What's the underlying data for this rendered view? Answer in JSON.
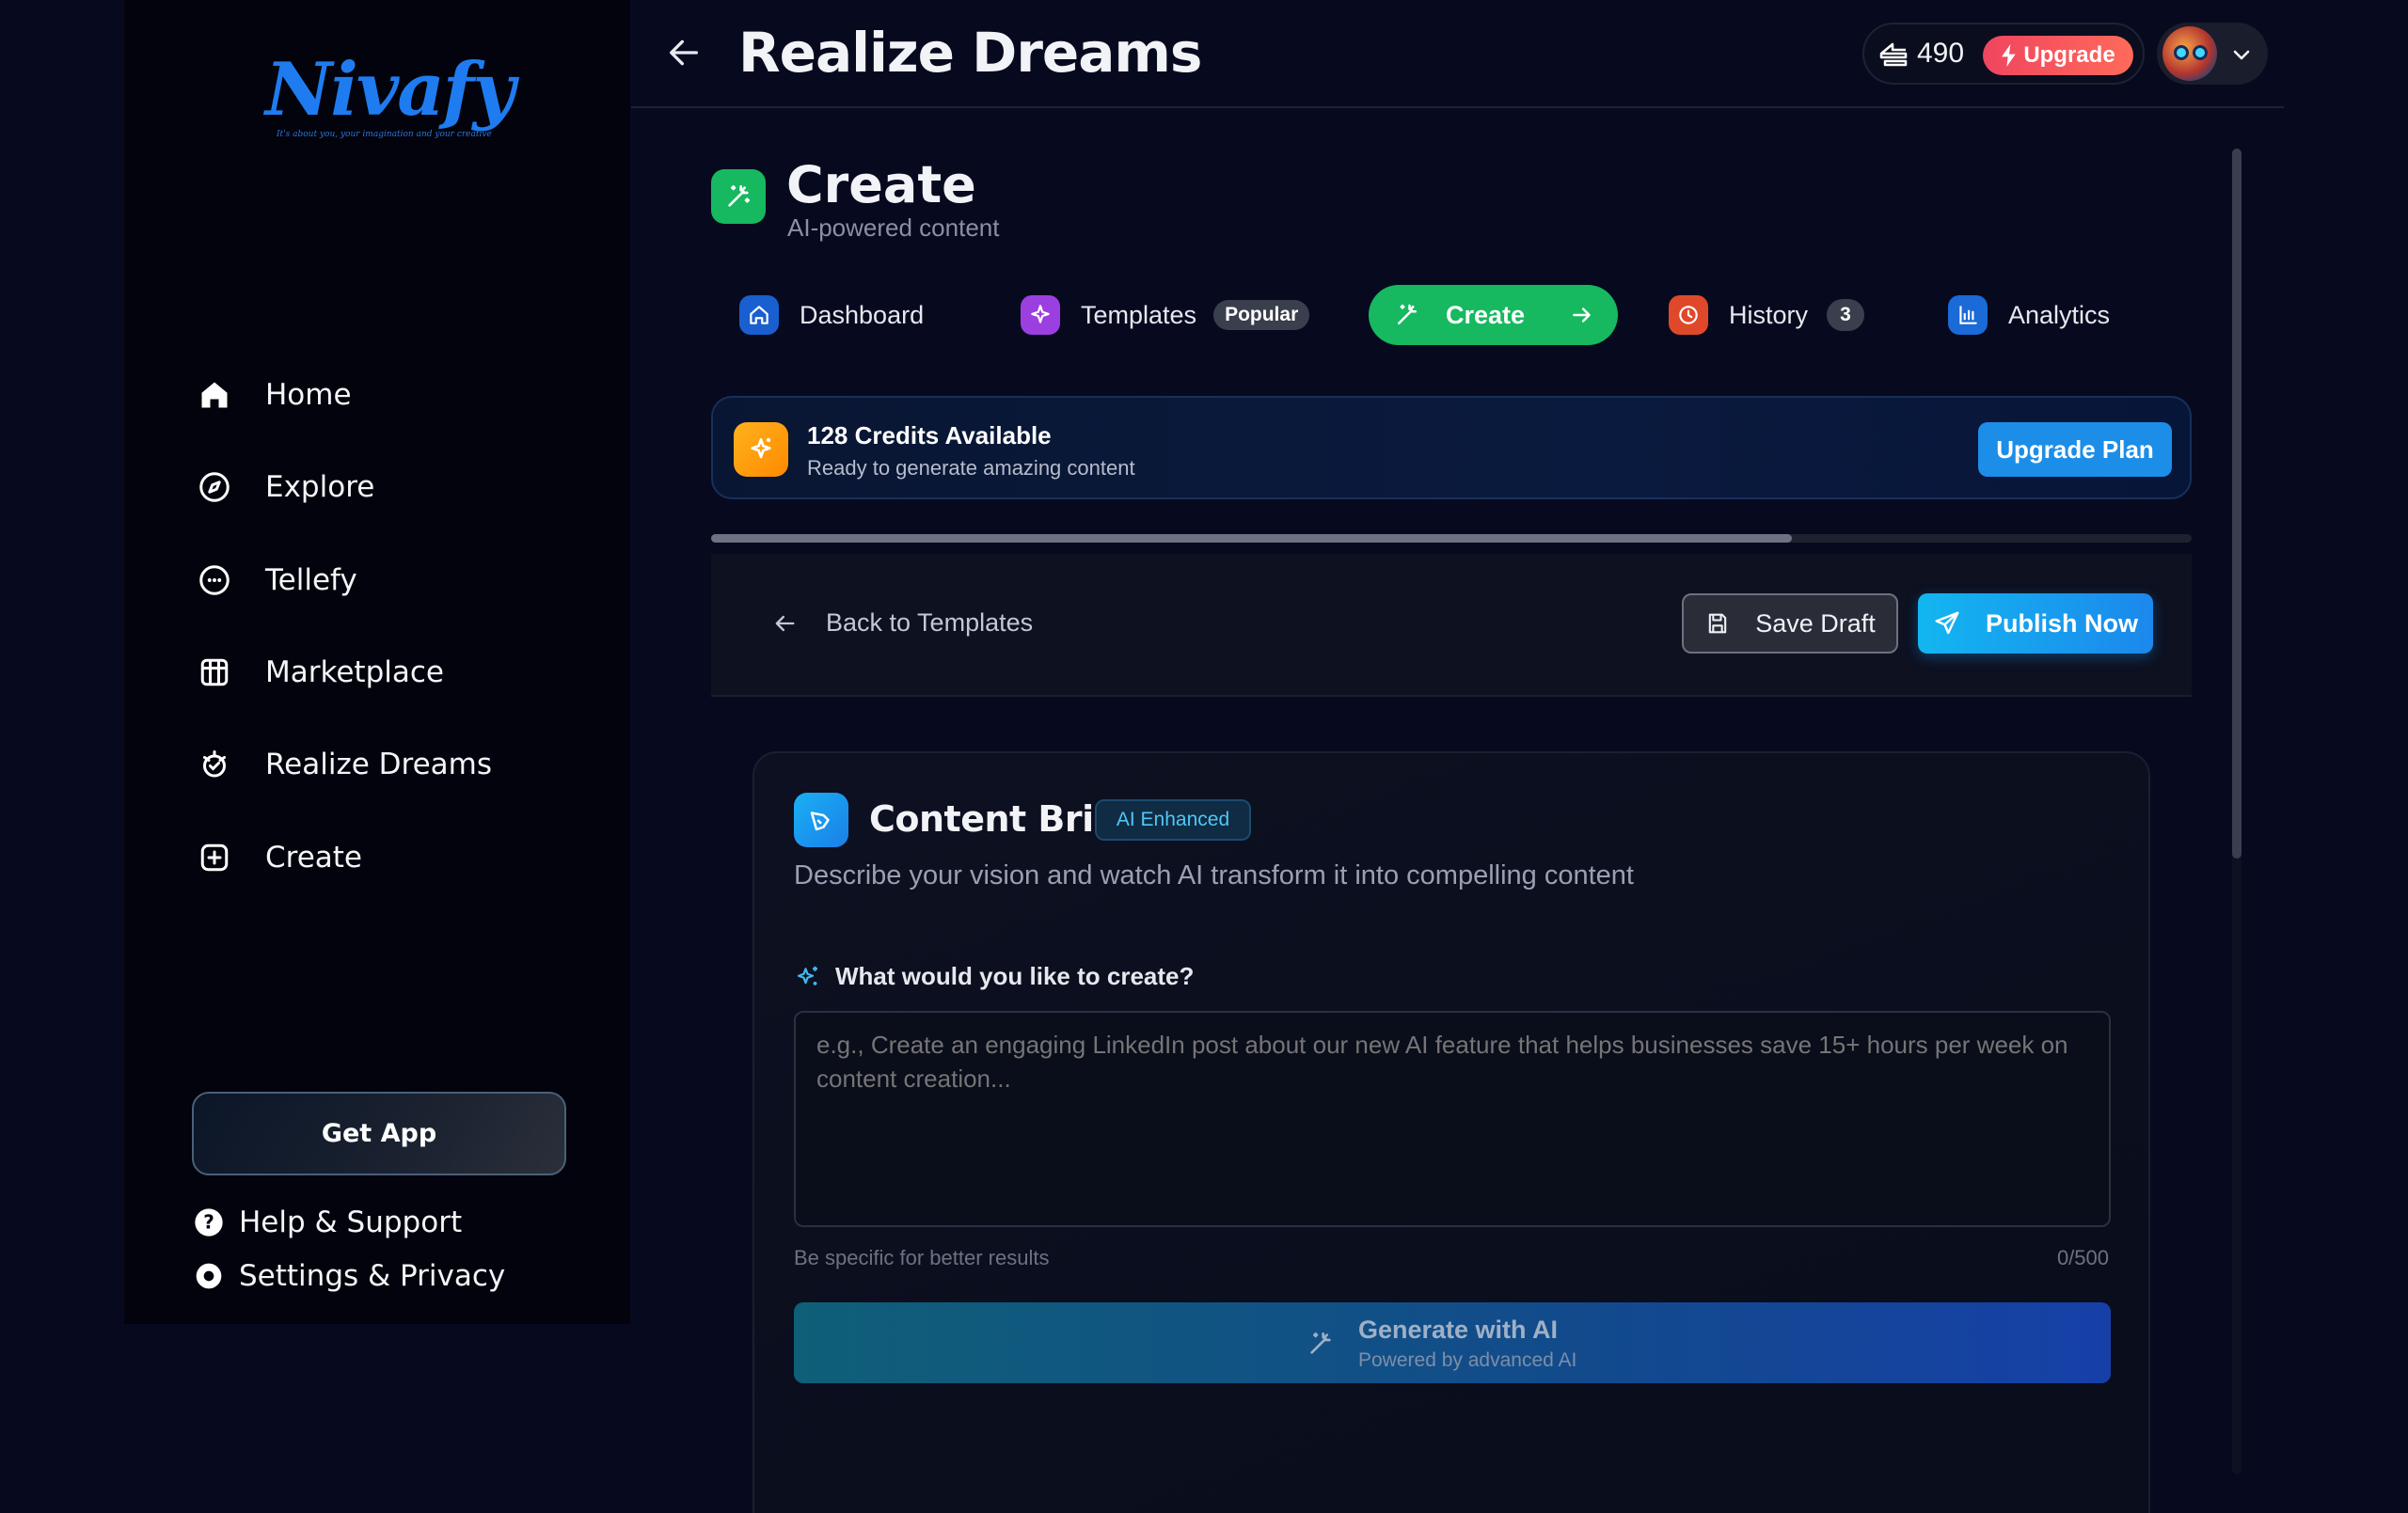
{
  "sidebar": {
    "logo": {
      "word": "Nivafy",
      "tagline": "It's about you, your imagination and your creative"
    },
    "items": [
      {
        "label": "Home",
        "icon": "home-icon"
      },
      {
        "label": "Explore",
        "icon": "compass-icon"
      },
      {
        "label": "Tellefy",
        "icon": "chat-icon"
      },
      {
        "label": "Marketplace",
        "icon": "store-icon"
      },
      {
        "label": "Realize Dreams",
        "icon": "dream-icon"
      },
      {
        "label": "Create",
        "icon": "plus-square-icon"
      }
    ],
    "get_app": "Get App",
    "help": "Help & Support",
    "settings": "Settings & Privacy"
  },
  "header": {
    "title": "Realize Dreams",
    "credits": "490",
    "upgrade": "Upgrade"
  },
  "page": {
    "title": "Create",
    "subtitle": "AI-powered content"
  },
  "tabs": [
    {
      "label": "Dashboard",
      "icon": "home-icon",
      "color": "#1a73e8"
    },
    {
      "label": "Templates",
      "icon": "sparkle-icon",
      "badge": "Popular",
      "color": "#9b3fe0"
    },
    {
      "label": "Create",
      "icon": "wand-icon",
      "active": true,
      "color": "#16b95f"
    },
    {
      "label": "History",
      "icon": "history-icon",
      "badge": "3",
      "color": "#e8452c"
    },
    {
      "label": "Analytics",
      "icon": "bar-chart-icon",
      "color": "#1a73e8"
    }
  ],
  "tab_progress": 0.73,
  "credits_card": {
    "title": "128 Credits Available",
    "subtitle": "Ready to generate amazing content",
    "button": "Upgrade Plan"
  },
  "toolbar": {
    "back": "Back to Templates",
    "save_draft": "Save Draft",
    "publish": "Publish Now"
  },
  "brief": {
    "title": "Content Brief",
    "badge": "AI Enhanced",
    "description": "Describe your vision and watch AI transform it into compelling content",
    "field_label": "What would you like to create?",
    "placeholder": "e.g., Create an engaging LinkedIn post about our new AI feature that helps businesses save 15+ hours per week on content creation...",
    "value": "",
    "hint": "Be specific for better results",
    "counter": "0/500",
    "generate_title": "Generate with AI",
    "generate_sub": "Powered by advanced AI"
  },
  "colors": {
    "accent_green": "#16b95f",
    "accent_blue": "#1c8ee8",
    "upgrade_red": "#f0455f",
    "background": "#070a1f"
  }
}
